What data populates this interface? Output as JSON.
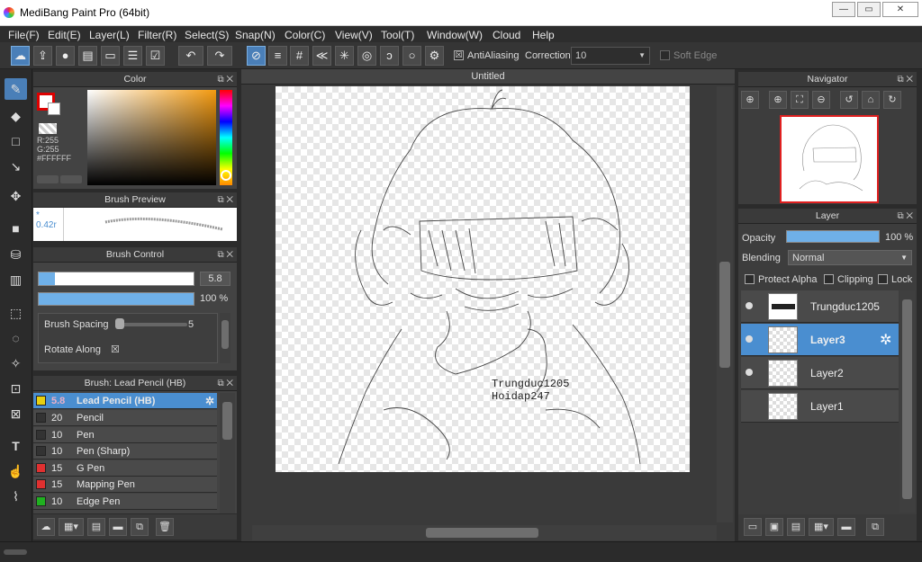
{
  "window": {
    "title": "MediBang Paint Pro (64bit)",
    "min": "—",
    "max": "▭",
    "close": "✕"
  },
  "menu": [
    "File(F)",
    "Edit(E)",
    "Layer(L)",
    "Filter(R)",
    "Select(S)",
    "Snap(N)",
    "Color(C)",
    "View(V)",
    "Tool(T)",
    "Window(W)",
    "Cloud",
    "Help"
  ],
  "toolbar": {
    "antialiasing": "AntiAliasing",
    "antialiasing_checked": "☒",
    "correction_label": "Correction",
    "correction_value": "10",
    "soft_edge": "Soft Edge",
    "dropdown": "▼"
  },
  "color_panel": {
    "title": "Color",
    "r": "R:255",
    "g": "G:255",
    "hex": "#FFFFFF"
  },
  "brush_preview": {
    "title": "Brush Preview",
    "size_label": "* 0.42r"
  },
  "brush_control": {
    "title": "Brush Control",
    "size_value": "5.8",
    "opacity_value": "100 %",
    "spacing_label": "Brush Spacing",
    "spacing_value": "5",
    "rotate_label": "Rotate Along",
    "rotate_checked": "☒"
  },
  "brush_list": {
    "title": "Brush: Lead Pencil (HB)",
    "items": [
      {
        "size": "5.8",
        "name": "Lead Pencil (HB)",
        "color": "#e8d010"
      },
      {
        "size": "20",
        "name": "Pencil",
        "color": "#333333"
      },
      {
        "size": "10",
        "name": "Pen",
        "color": "#333333"
      },
      {
        "size": "10",
        "name": "Pen (Sharp)",
        "color": "#333333"
      },
      {
        "size": "15",
        "name": "G Pen",
        "color": "#e03030"
      },
      {
        "size": "15",
        "name": "Mapping Pen",
        "color": "#e03030"
      },
      {
        "size": "10",
        "name": "Edge Pen",
        "color": "#20b020"
      }
    ]
  },
  "canvas": {
    "tab_title": "Untitled",
    "text_line1": "Trungduc1205",
    "text_line2": "Hoidap247"
  },
  "navigator": {
    "title": "Navigator"
  },
  "layer_panel": {
    "title": "Layer",
    "opacity_label": "Opacity",
    "opacity_value": "100 %",
    "blending_label": "Blending",
    "blending_value": "Normal",
    "protect_alpha": "Protect Alpha",
    "clipping": "Clipping",
    "lock": "Lock",
    "layers": [
      {
        "name": "Trungduc1205",
        "visible": true,
        "selected": false
      },
      {
        "name": "Layer3",
        "visible": true,
        "selected": true
      },
      {
        "name": "Layer2",
        "visible": true,
        "selected": false
      },
      {
        "name": "Layer1",
        "visible": false,
        "selected": false
      }
    ]
  },
  "colors": {
    "accent": "#4a8ed0",
    "panel": "#434343",
    "header": "#3a3a3a",
    "bg": "#2b2b2b"
  }
}
